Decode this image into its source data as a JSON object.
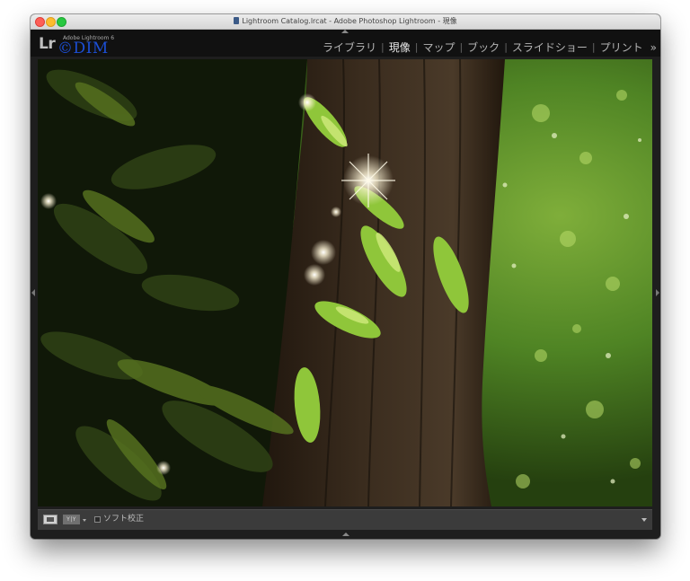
{
  "window": {
    "title": "Lightroom Catalog.lrcat - Adobe Photoshop Lightroom - 現像"
  },
  "identity": {
    "logo": "Lr",
    "product": "Adobe Lightroom 6",
    "watermark": "©DIM"
  },
  "modules": {
    "items": [
      {
        "label": "ライブラリ",
        "active": false
      },
      {
        "label": "現像",
        "active": true
      },
      {
        "label": "マップ",
        "active": false
      },
      {
        "label": "ブック",
        "active": false
      },
      {
        "label": "スライドショー",
        "active": false
      },
      {
        "label": "プリント",
        "active": false
      }
    ],
    "separator": "|",
    "more": "»"
  },
  "toolbar": {
    "compare_label": "Y|Y",
    "softproof_label": "ソフト校正"
  },
  "colors": {
    "accent_watermark": "#1c4fd6",
    "panel_bg": "#111111",
    "toolbar_bg": "#3b3b3b"
  }
}
